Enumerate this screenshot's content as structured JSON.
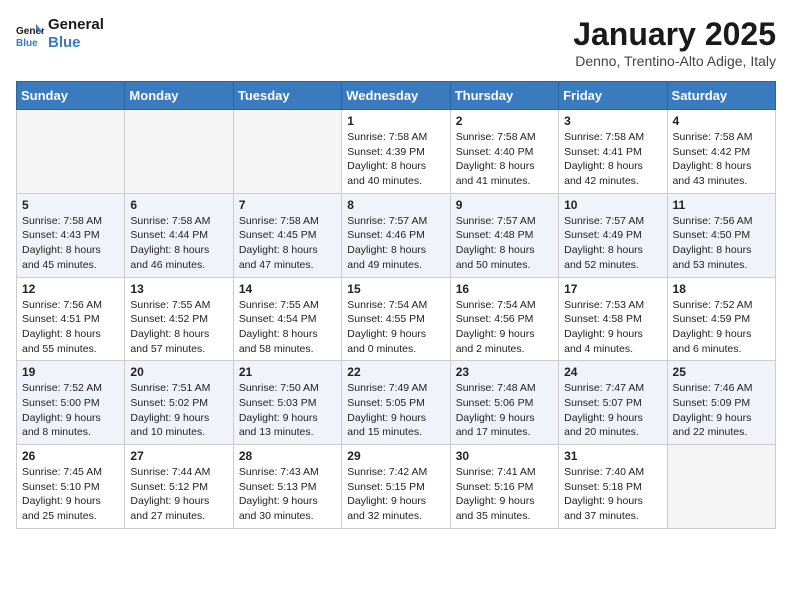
{
  "header": {
    "logo_line1": "General",
    "logo_line2": "Blue",
    "month": "January 2025",
    "location": "Denno, Trentino-Alto Adige, Italy"
  },
  "weekdays": [
    "Sunday",
    "Monday",
    "Tuesday",
    "Wednesday",
    "Thursday",
    "Friday",
    "Saturday"
  ],
  "weeks": [
    [
      {
        "day": "",
        "sunrise": "",
        "sunset": "",
        "daylight": ""
      },
      {
        "day": "",
        "sunrise": "",
        "sunset": "",
        "daylight": ""
      },
      {
        "day": "",
        "sunrise": "",
        "sunset": "",
        "daylight": ""
      },
      {
        "day": "1",
        "sunrise": "Sunrise: 7:58 AM",
        "sunset": "Sunset: 4:39 PM",
        "daylight": "Daylight: 8 hours and 40 minutes."
      },
      {
        "day": "2",
        "sunrise": "Sunrise: 7:58 AM",
        "sunset": "Sunset: 4:40 PM",
        "daylight": "Daylight: 8 hours and 41 minutes."
      },
      {
        "day": "3",
        "sunrise": "Sunrise: 7:58 AM",
        "sunset": "Sunset: 4:41 PM",
        "daylight": "Daylight: 8 hours and 42 minutes."
      },
      {
        "day": "4",
        "sunrise": "Sunrise: 7:58 AM",
        "sunset": "Sunset: 4:42 PM",
        "daylight": "Daylight: 8 hours and 43 minutes."
      }
    ],
    [
      {
        "day": "5",
        "sunrise": "Sunrise: 7:58 AM",
        "sunset": "Sunset: 4:43 PM",
        "daylight": "Daylight: 8 hours and 45 minutes."
      },
      {
        "day": "6",
        "sunrise": "Sunrise: 7:58 AM",
        "sunset": "Sunset: 4:44 PM",
        "daylight": "Daylight: 8 hours and 46 minutes."
      },
      {
        "day": "7",
        "sunrise": "Sunrise: 7:58 AM",
        "sunset": "Sunset: 4:45 PM",
        "daylight": "Daylight: 8 hours and 47 minutes."
      },
      {
        "day": "8",
        "sunrise": "Sunrise: 7:57 AM",
        "sunset": "Sunset: 4:46 PM",
        "daylight": "Daylight: 8 hours and 49 minutes."
      },
      {
        "day": "9",
        "sunrise": "Sunrise: 7:57 AM",
        "sunset": "Sunset: 4:48 PM",
        "daylight": "Daylight: 8 hours and 50 minutes."
      },
      {
        "day": "10",
        "sunrise": "Sunrise: 7:57 AM",
        "sunset": "Sunset: 4:49 PM",
        "daylight": "Daylight: 8 hours and 52 minutes."
      },
      {
        "day": "11",
        "sunrise": "Sunrise: 7:56 AM",
        "sunset": "Sunset: 4:50 PM",
        "daylight": "Daylight: 8 hours and 53 minutes."
      }
    ],
    [
      {
        "day": "12",
        "sunrise": "Sunrise: 7:56 AM",
        "sunset": "Sunset: 4:51 PM",
        "daylight": "Daylight: 8 hours and 55 minutes."
      },
      {
        "day": "13",
        "sunrise": "Sunrise: 7:55 AM",
        "sunset": "Sunset: 4:52 PM",
        "daylight": "Daylight: 8 hours and 57 minutes."
      },
      {
        "day": "14",
        "sunrise": "Sunrise: 7:55 AM",
        "sunset": "Sunset: 4:54 PM",
        "daylight": "Daylight: 8 hours and 58 minutes."
      },
      {
        "day": "15",
        "sunrise": "Sunrise: 7:54 AM",
        "sunset": "Sunset: 4:55 PM",
        "daylight": "Daylight: 9 hours and 0 minutes."
      },
      {
        "day": "16",
        "sunrise": "Sunrise: 7:54 AM",
        "sunset": "Sunset: 4:56 PM",
        "daylight": "Daylight: 9 hours and 2 minutes."
      },
      {
        "day": "17",
        "sunrise": "Sunrise: 7:53 AM",
        "sunset": "Sunset: 4:58 PM",
        "daylight": "Daylight: 9 hours and 4 minutes."
      },
      {
        "day": "18",
        "sunrise": "Sunrise: 7:52 AM",
        "sunset": "Sunset: 4:59 PM",
        "daylight": "Daylight: 9 hours and 6 minutes."
      }
    ],
    [
      {
        "day": "19",
        "sunrise": "Sunrise: 7:52 AM",
        "sunset": "Sunset: 5:00 PM",
        "daylight": "Daylight: 9 hours and 8 minutes."
      },
      {
        "day": "20",
        "sunrise": "Sunrise: 7:51 AM",
        "sunset": "Sunset: 5:02 PM",
        "daylight": "Daylight: 9 hours and 10 minutes."
      },
      {
        "day": "21",
        "sunrise": "Sunrise: 7:50 AM",
        "sunset": "Sunset: 5:03 PM",
        "daylight": "Daylight: 9 hours and 13 minutes."
      },
      {
        "day": "22",
        "sunrise": "Sunrise: 7:49 AM",
        "sunset": "Sunset: 5:05 PM",
        "daylight": "Daylight: 9 hours and 15 minutes."
      },
      {
        "day": "23",
        "sunrise": "Sunrise: 7:48 AM",
        "sunset": "Sunset: 5:06 PM",
        "daylight": "Daylight: 9 hours and 17 minutes."
      },
      {
        "day": "24",
        "sunrise": "Sunrise: 7:47 AM",
        "sunset": "Sunset: 5:07 PM",
        "daylight": "Daylight: 9 hours and 20 minutes."
      },
      {
        "day": "25",
        "sunrise": "Sunrise: 7:46 AM",
        "sunset": "Sunset: 5:09 PM",
        "daylight": "Daylight: 9 hours and 22 minutes."
      }
    ],
    [
      {
        "day": "26",
        "sunrise": "Sunrise: 7:45 AM",
        "sunset": "Sunset: 5:10 PM",
        "daylight": "Daylight: 9 hours and 25 minutes."
      },
      {
        "day": "27",
        "sunrise": "Sunrise: 7:44 AM",
        "sunset": "Sunset: 5:12 PM",
        "daylight": "Daylight: 9 hours and 27 minutes."
      },
      {
        "day": "28",
        "sunrise": "Sunrise: 7:43 AM",
        "sunset": "Sunset: 5:13 PM",
        "daylight": "Daylight: 9 hours and 30 minutes."
      },
      {
        "day": "29",
        "sunrise": "Sunrise: 7:42 AM",
        "sunset": "Sunset: 5:15 PM",
        "daylight": "Daylight: 9 hours and 32 minutes."
      },
      {
        "day": "30",
        "sunrise": "Sunrise: 7:41 AM",
        "sunset": "Sunset: 5:16 PM",
        "daylight": "Daylight: 9 hours and 35 minutes."
      },
      {
        "day": "31",
        "sunrise": "Sunrise: 7:40 AM",
        "sunset": "Sunset: 5:18 PM",
        "daylight": "Daylight: 9 hours and 37 minutes."
      },
      {
        "day": "",
        "sunrise": "",
        "sunset": "",
        "daylight": ""
      }
    ]
  ]
}
